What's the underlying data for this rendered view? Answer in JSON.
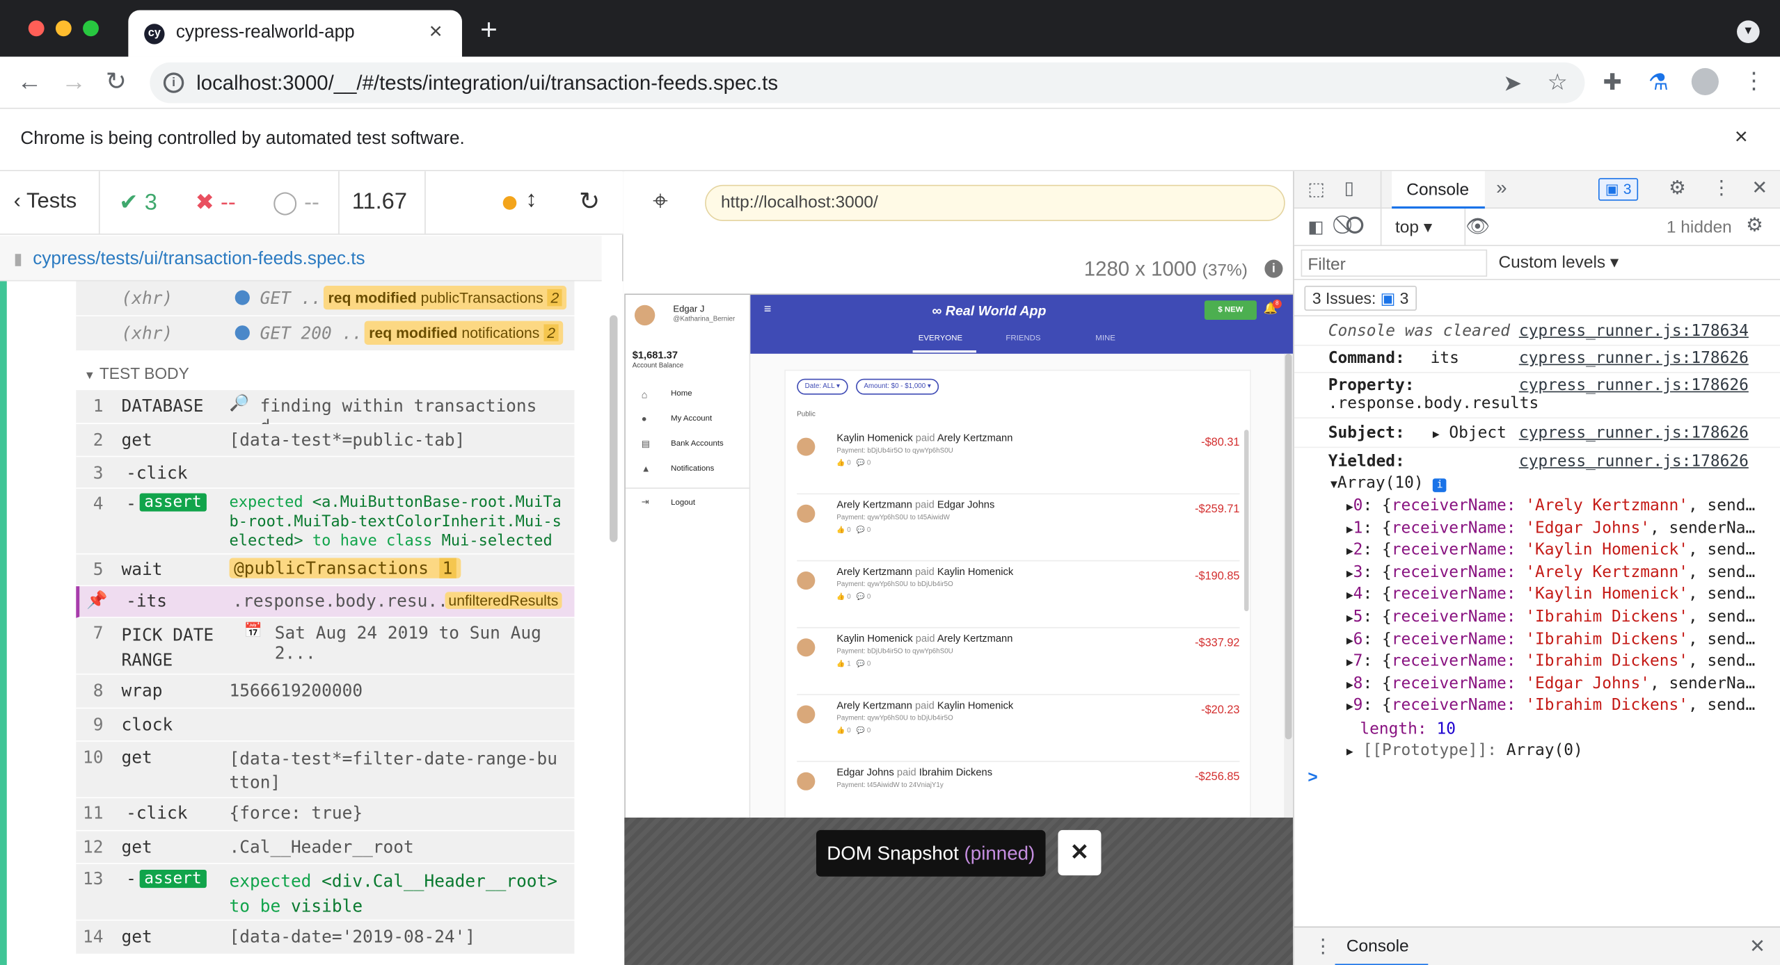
{
  "browser": {
    "tab_title": "cypress-realworld-app",
    "tab_icon": "cy",
    "url": "localhost:3000/__/#/tests/integration/ui/transaction-feeds.spec.ts",
    "infobar": "Chrome is being controlled by automated test software.",
    "new_tab_symbol": "+",
    "close_symbol": "×"
  },
  "reporter": {
    "tests_label": "Tests",
    "passed": "3",
    "failed": "--",
    "pending": "--",
    "duration": "11.67",
    "spec_path": "cypress/tests/ui/transaction-feeds.spec.ts",
    "xhr_rows": [
      {
        "name": "(xhr)",
        "msg": "GET ...",
        "alias_bold": "req modified",
        "alias": "publicTransactions",
        "count": "2"
      },
      {
        "name": "(xhr)",
        "msg": "GET 200 ...",
        "alias_bold": "req modified",
        "alias": "notifications",
        "count": "2"
      }
    ],
    "test_body_label": "TEST BODY",
    "commands": [
      {
        "num": "1",
        "name": "DATABASE",
        "msg": "finding within transactions d..."
      },
      {
        "num": "2",
        "name": "get",
        "msg": "[data-test*=public-tab]"
      },
      {
        "num": "3",
        "name": "-click",
        "msg": ""
      },
      {
        "num": "4",
        "name": "-",
        "assert": "assert",
        "msg1": "expected",
        "msg2": "<a.MuiButtonBase-root.MuiTab-root.MuiTab-textColorInherit.Mui-selected>",
        "msg3": "to have class",
        "msg4": "Mui-selected"
      },
      {
        "num": "5",
        "name": "wait",
        "msg": "@publicTransactions",
        "count": "1"
      },
      {
        "num": "",
        "name": "-its",
        "msg": ".response.body.resu...",
        "badge": "unfilteredResults"
      },
      {
        "num": "7",
        "name": "PICK DATE RANGE",
        "msg": "Sat Aug 24 2019 to Sun Aug 2..."
      },
      {
        "num": "8",
        "name": "wrap",
        "msg": "1566619200000"
      },
      {
        "num": "9",
        "name": "clock",
        "msg": ""
      },
      {
        "num": "10",
        "name": "get",
        "msg": "[data-test*=filter-date-range-button]"
      },
      {
        "num": "11",
        "name": "-click",
        "msg": "{force: true}"
      },
      {
        "num": "12",
        "name": "get",
        "msg": ".Cal__Header__root"
      },
      {
        "num": "13",
        "name": "-",
        "assert": "assert",
        "msg1": "expected",
        "msg2": "<div.Cal__Header__root>",
        "msg3": "to be",
        "msg4": "visible"
      },
      {
        "num": "14",
        "name": "get",
        "msg": "[data-date='2019-08-24']"
      }
    ]
  },
  "aut": {
    "url": "http://localhost:3000/",
    "viewport": "1280 x 1000",
    "zoom": "(37%)",
    "snapshot_label": "DOM Snapshot",
    "snapshot_state": "(pinned)",
    "app": {
      "user_name": "Edgar J",
      "user_handle": "@Katharina_Bernier",
      "balance": "$1,681.37",
      "balance_label": "Account Balance",
      "nav": [
        "Home",
        "My Account",
        "Bank Accounts",
        "Notifications",
        "Logout"
      ],
      "title": "Real World App",
      "new_button": "$ NEW",
      "notif_count": "8",
      "tabs": [
        "EVERYONE",
        "FRIENDS",
        "MINE"
      ],
      "filter_date": "Date: ALL",
      "filter_amount": "Amount: $0 - $1,000",
      "section_label": "Public",
      "transactions": [
        {
          "sender": "Kaylin Homenick",
          "verb": "paid",
          "receiver": "Arely Kertzmann",
          "amount": "-$80.31",
          "payment": "Payment: bDjUb4ir5O to qywYp6hS0U",
          "likes": "0",
          "comments": "0"
        },
        {
          "sender": "Arely Kertzmann",
          "verb": "paid",
          "receiver": "Edgar Johns",
          "amount": "-$259.71",
          "payment": "Payment: qywYp6hS0U to t45AiwidW",
          "likes": "0",
          "comments": "0"
        },
        {
          "sender": "Arely Kertzmann",
          "verb": "paid",
          "receiver": "Kaylin Homenick",
          "amount": "-$190.85",
          "payment": "Payment: qywYp6hS0U to bDjUb4ir5O",
          "likes": "0",
          "comments": "0"
        },
        {
          "sender": "Kaylin Homenick",
          "verb": "paid",
          "receiver": "Arely Kertzmann",
          "amount": "-$337.92",
          "payment": "Payment: bDjUb4ir5O to qywYp6hS0U",
          "likes": "1",
          "comments": "0"
        },
        {
          "sender": "Arely Kertzmann",
          "verb": "paid",
          "receiver": "Kaylin Homenick",
          "amount": "-$20.23",
          "payment": "Payment: qywYp6hS0U to bDjUb4ir5O",
          "likes": "0",
          "comments": "0"
        },
        {
          "sender": "Edgar Johns",
          "verb": "paid",
          "receiver": "Ibrahim Dickens",
          "amount": "-$256.85",
          "payment": "Payment: t45AiwidW to 24VniajY1y",
          "likes": "",
          "comments": ""
        }
      ]
    }
  },
  "devtools": {
    "tab_console": "Console",
    "issues_count": "3",
    "context": "top",
    "hidden": "1 hidden",
    "filter_placeholder": "Filter",
    "levels": "Custom levels",
    "issues_label": "3 Issues:",
    "issues_num": "3",
    "lines": [
      {
        "label": "Console was cleared",
        "source": "cypress_runner.js:178634"
      },
      {
        "label": "Command:",
        "value": "its",
        "source": "cypress_runner.js:178626"
      },
      {
        "label": "Property:",
        "value": ".response.body.results",
        "source": "cypress_runner.js:178626"
      },
      {
        "label": "Subject:",
        "value": "Object",
        "source": "cypress_runner.js:178626"
      },
      {
        "label": "Yielded:",
        "value": "Array(10)",
        "source": "cypress_runner.js:178626"
      }
    ],
    "array_items": [
      {
        "idx": "0",
        "name": "'Arely Kertzmann'",
        "rest": ", send…"
      },
      {
        "idx": "1",
        "name": "'Edgar Johns'",
        "rest": ", senderNa…"
      },
      {
        "idx": "2",
        "name": "'Kaylin Homenick'",
        "rest": ", send…"
      },
      {
        "idx": "3",
        "name": "'Arely Kertzmann'",
        "rest": ", send…"
      },
      {
        "idx": "4",
        "name": "'Kaylin Homenick'",
        "rest": ", send…"
      },
      {
        "idx": "5",
        "name": "'Ibrahim Dickens'",
        "rest": ", send…"
      },
      {
        "idx": "6",
        "name": "'Ibrahim Dickens'",
        "rest": ", send…"
      },
      {
        "idx": "7",
        "name": "'Ibrahim Dickens'",
        "rest": ", send…"
      },
      {
        "idx": "8",
        "name": "'Edgar Johns'",
        "rest": ", senderNa…"
      },
      {
        "idx": "9",
        "name": "'Ibrahim Dickens'",
        "rest": ", send…"
      }
    ],
    "array_key": "receiverName:",
    "length_label": "length:",
    "length_value": "10",
    "prototype_label": "[[Prototype]]:",
    "prototype_value": "Array(0)",
    "prompt": ">",
    "drawer_tab": "Console"
  },
  "colors": {
    "cypress_green": "#3fc596",
    "rwa_blue": "#3f4bb5",
    "failed_red": "#e94f5f"
  }
}
